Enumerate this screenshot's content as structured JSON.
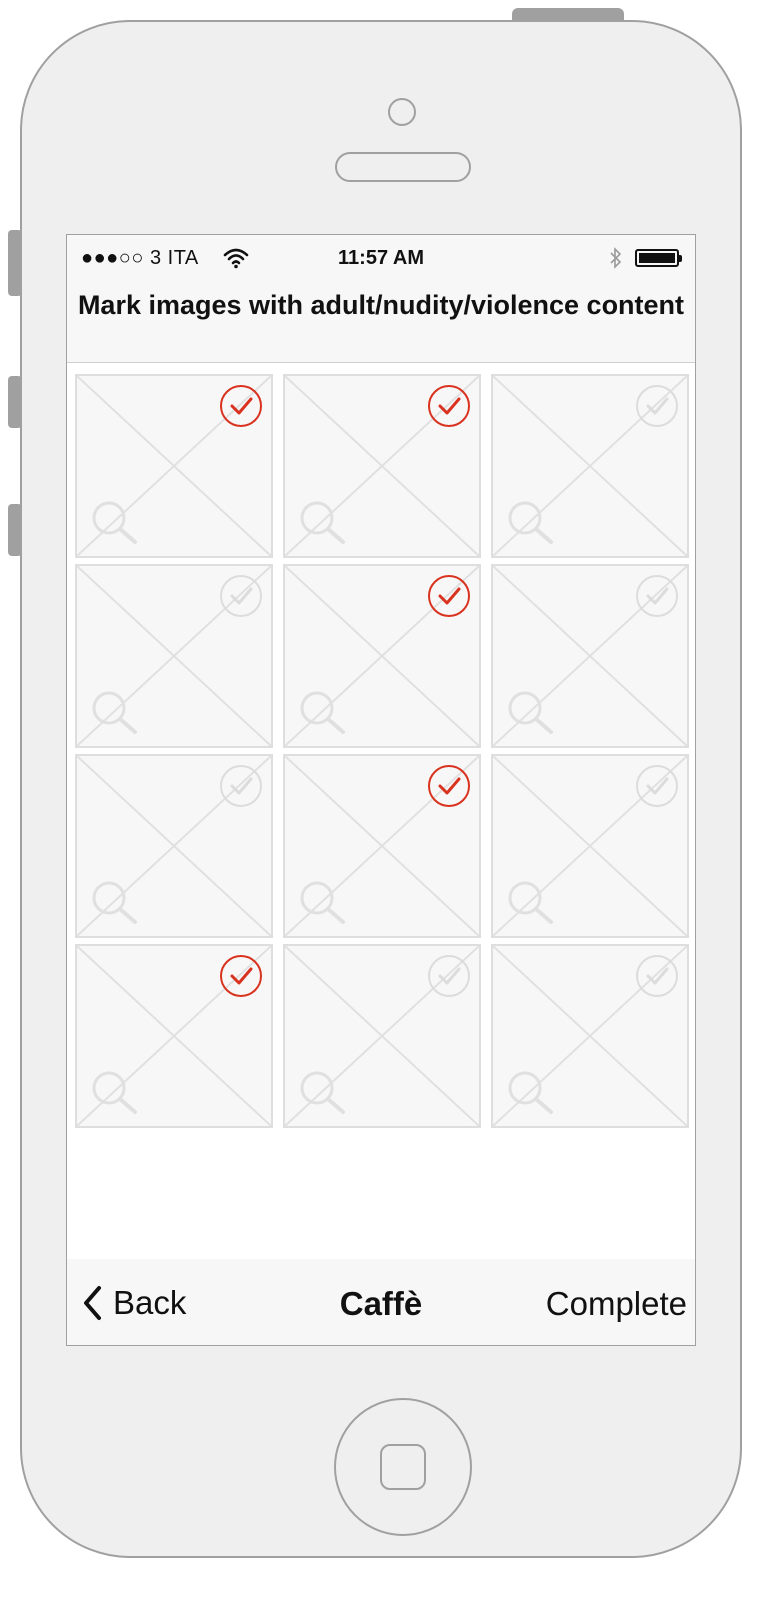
{
  "status_bar": {
    "carrier": "●●●○○ 3 ITA",
    "time": "11:57 AM",
    "icons": [
      "wifi-icon",
      "bluetooth-icon",
      "battery-icon"
    ]
  },
  "header": {
    "title": "Mark images with adult/nudity/violence content"
  },
  "grid": {
    "columns": 3,
    "tiles": [
      {
        "checked": true
      },
      {
        "checked": true
      },
      {
        "checked": false
      },
      {
        "checked": false
      },
      {
        "checked": true
      },
      {
        "checked": false
      },
      {
        "checked": false
      },
      {
        "checked": true
      },
      {
        "checked": false
      },
      {
        "checked": true
      },
      {
        "checked": false
      },
      {
        "checked": false
      }
    ]
  },
  "toolbar": {
    "back_label": "Back",
    "title": "Caffè",
    "complete_label": "Complete"
  },
  "colors": {
    "checked": "#d9321f",
    "unchecked": "#dcdcdc",
    "placeholder_lines": "#e0e0e0"
  }
}
